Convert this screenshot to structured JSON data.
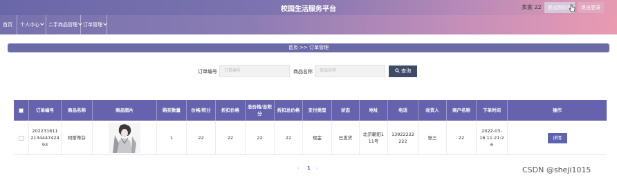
{
  "header": {
    "title": "校园生活服务平台",
    "seller": "卖家 22",
    "exit_to_front": "退出到前台",
    "logout": "退出登录"
  },
  "nav": {
    "items": [
      {
        "label": "首页"
      },
      {
        "label": "个人中心"
      },
      {
        "label": "二手商品管理"
      },
      {
        "label": "订单管理"
      }
    ]
  },
  "breadcrumb": "首页  >>  订单管理",
  "search": {
    "order_no_label": "订单编号",
    "order_no_placeholder": "订单编号",
    "product_name_label": "商品名称",
    "product_name_placeholder": "商品名称",
    "query_label": "查询"
  },
  "table": {
    "columns": [
      "订单编号",
      "商品名称",
      "商品图片",
      "购买数量",
      "价格/积分",
      "折扣价格",
      "总价格/总积分",
      "折扣总价格",
      "支付类型",
      "状态",
      "地址",
      "电话",
      "收货人",
      "商户名称",
      "下单时间",
      "操作"
    ],
    "rows": [
      {
        "order_no": "2022316112134447424 93",
        "order_no_display": "202231611\n2134447424\n93",
        "product_name": "阿斯蒂芬",
        "quantity": "1",
        "price": "22",
        "discount_price": "22",
        "total": "22",
        "discount_total": "22",
        "pay_type": "现金",
        "status": "已发货",
        "address": "北京朝阳1\n11号",
        "phone": "13922222\n222",
        "receiver": "张三",
        "merchant": "22",
        "order_time": "2022-03-\n16 11:21:2\n6",
        "action": "详情"
      }
    ]
  },
  "pager": {
    "prev": "‹",
    "current": "1",
    "next": "›"
  },
  "watermark": "CSDN @sheji1015",
  "colors": {
    "header_accent": "#6563ad",
    "search_button": "#3e4a66"
  }
}
